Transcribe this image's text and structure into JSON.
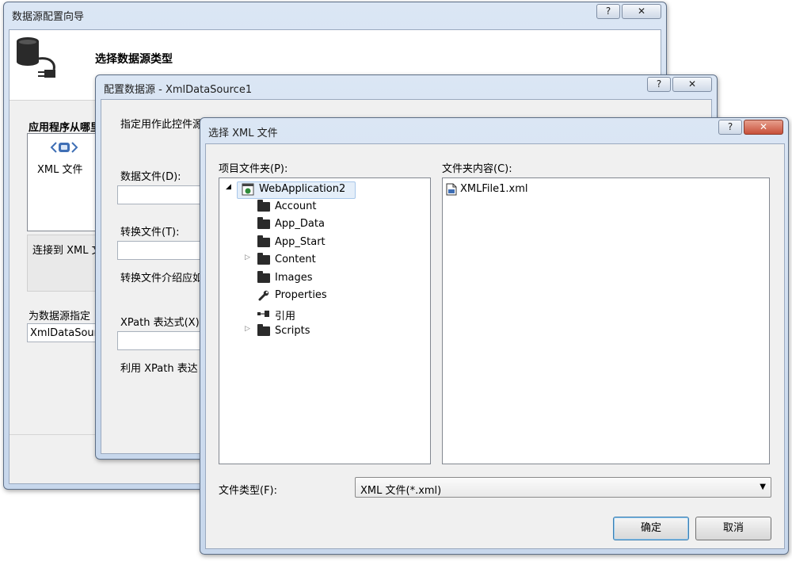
{
  "wizard": {
    "title": "数据源配置向导",
    "help_label": "?",
    "close_label": "✕",
    "header_title": "选择数据源类型",
    "question_label": "应用程序从哪里",
    "xml_item_label": "XML 文件",
    "description": "连接到 XML 文",
    "id_label": "为数据源指定",
    "id_value": "XmlDataSour"
  },
  "configure": {
    "title": "配置数据源 - XmlDataSource1",
    "help_label": "?",
    "close_label": "✕",
    "instruction": "指定用作此控件源",
    "data_file_label": "数据文件(D):",
    "data_file_value": "",
    "transform_file_label": "转换文件(T):",
    "transform_file_value": "",
    "transform_hint": "转换文件介绍应如",
    "xpath_label": "XPath 表达式(X)",
    "xpath_value": "",
    "xpath_hint": "利用 XPath 表达"
  },
  "select_xml": {
    "title": "选择 XML 文件",
    "help_label": "?",
    "close_label": "✕",
    "project_folders_label": "项目文件夹(P):",
    "folder_contents_label": "文件夹内容(C):",
    "tree": {
      "root": "WebApplication2",
      "children": [
        {
          "label": "Account",
          "icon": "folder-icon",
          "expandable": false
        },
        {
          "label": "App_Data",
          "icon": "folder-icon",
          "expandable": false
        },
        {
          "label": "App_Start",
          "icon": "folder-icon",
          "expandable": false
        },
        {
          "label": "Content",
          "icon": "folder-icon",
          "expandable": true
        },
        {
          "label": "Images",
          "icon": "folder-icon",
          "expandable": false
        },
        {
          "label": "Properties",
          "icon": "wrench-icon",
          "expandable": false
        },
        {
          "label": "引用",
          "icon": "reference-icon",
          "expandable": false
        },
        {
          "label": "Scripts",
          "icon": "folder-icon",
          "expandable": true
        }
      ]
    },
    "files": [
      "XMLFile1.xml"
    ],
    "file_type_label": "文件类型(F):",
    "file_type_value": "XML 文件(*.xml)",
    "ok_label": "确定",
    "cancel_label": "取消"
  }
}
